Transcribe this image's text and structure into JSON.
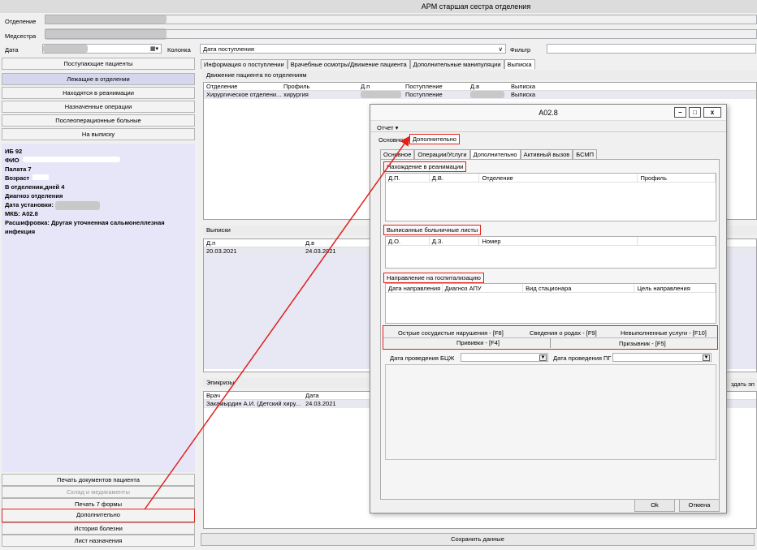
{
  "app": {
    "title": "АРМ старшая сестра отделения"
  },
  "header": {
    "otdelenie_label": "Отделение",
    "medsestra_label": "Медсестра",
    "data_label": "Дата",
    "kolonka_label": "Колонка",
    "kolonka_value": "Дата поступления",
    "filter_label": "Фильтр"
  },
  "nav": {
    "items": [
      "Поступающие пациенты",
      "Лежащие в отделении",
      "Находятся в реанимации",
      "Назначенные операции",
      "Послеоперационные больные",
      "На выписку"
    ],
    "bottom": [
      "Печать документов пациента",
      "Склад и медикаменты",
      "Печать 7 формы",
      "Дополнительно",
      "История болезни",
      "Лист назначения"
    ]
  },
  "patient": {
    "ib": "ИБ 92",
    "fio": "ФИО",
    "palata": "Палата 7",
    "vozrast": "Возраст",
    "days": "В отделении,дней 4",
    "diag": "Диагноз отделения",
    "date_install": "Дата установки:",
    "mkb": "МКБ: A02.8",
    "rasshifrovka": "Расшифровка: Другая уточненная сальмонеллезная инфекция"
  },
  "main": {
    "tabs": [
      "Информация о поступлении",
      "Врачебные осмотры/Движение пациента",
      "Дополнительные манипуляции",
      "Выписка"
    ],
    "movement_title": "Движение пациента по отделениям",
    "movement_cols": [
      "Отделение",
      "Профиль",
      "Д.п",
      "Поступление",
      "Д.в",
      "Выписка"
    ],
    "movement_row": {
      "otd": "Хирургическое отделени...",
      "profile": "хирургия",
      "post": "Поступление",
      "vyp": "Выписка"
    },
    "vypiski_title": "Выписки",
    "vypiski_cols": [
      "Д.п",
      "Д.в"
    ],
    "vypiski_row": [
      "20.03.2021",
      "24.03.2021"
    ],
    "epikrizy_title": "Эпикризы",
    "epikrizy_cols": [
      "Врач",
      "Дата"
    ],
    "epikrizy_row": [
      "Закамырдин А.И. (Детский хиру...",
      "24.03.2021"
    ],
    "create_label": "здать эп",
    "save_label": "Сохранить данные"
  },
  "dialog": {
    "title": "A02.8",
    "menu_otchet": "Отчет ▾",
    "top_tabs": [
      "Основное",
      "Дополнительно"
    ],
    "sub_tabs": [
      "Основное",
      "Операции/Услуги",
      "Дополнительно",
      "Активный вызов",
      "БСМП"
    ],
    "reanim_title": "Нахождение в реанимации",
    "reanim_cols": [
      "Д.П.",
      "Д.В.",
      "Отделение",
      "Профиль"
    ],
    "bolnich_title": "Выписанные больничные листы",
    "bolnich_cols": [
      "Д.О.",
      "Д.З.",
      "Номер"
    ],
    "gosp_title": "Направление на госпитализацию",
    "gosp_cols": [
      "Дата направления",
      "Диагноз АПУ",
      "Вид стационара",
      "Цель направления"
    ],
    "lower_tabs_row1": [
      "Острые сосудистые нарушения - [F8]",
      "Сведения о родах - [F9]",
      "Невыполненные услуги - [F10]"
    ],
    "lower_tabs_row2": [
      "Прививки - [F4]",
      "Призывник - [F5]"
    ],
    "bcg_label": "Дата проведения БЦЖ",
    "pg_label": "Дата проведения ПГ",
    "ok": "Ok",
    "cancel": "Отмена"
  },
  "colors": {
    "highlight": "#e0201a",
    "active_nav": "#d6d6ee"
  }
}
